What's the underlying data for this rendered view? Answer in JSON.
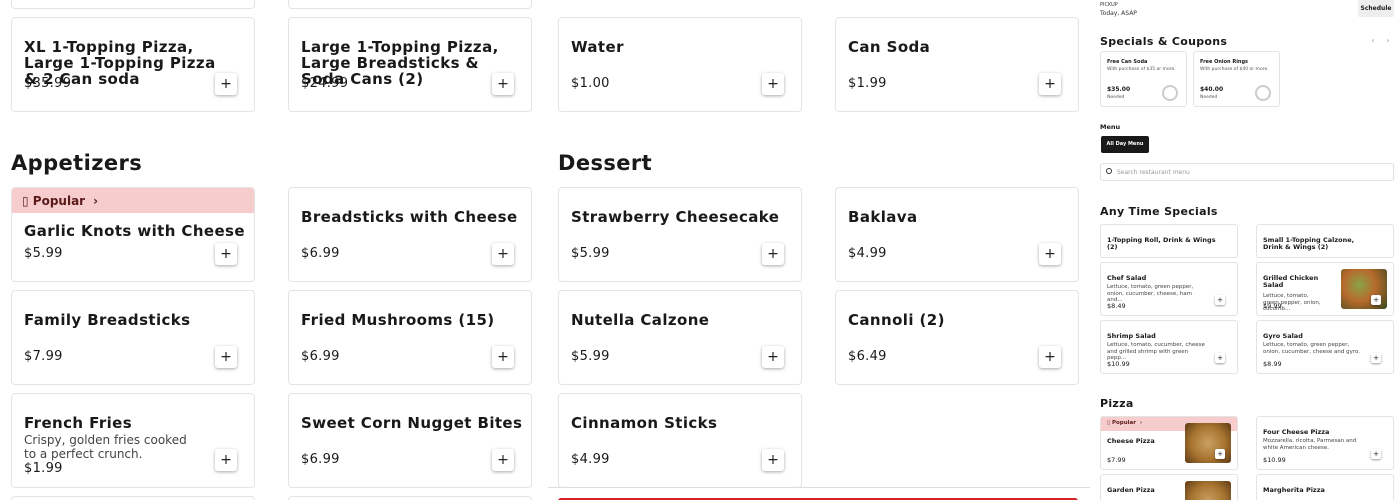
{
  "combos": [
    {
      "name": "XL 1-Topping Pizza, Large 1-Topping Pizza & 2 Can soda",
      "price": "$35.99"
    },
    {
      "name": "Large 1-Topping Pizza, Large Breadsticks & Soda Cans (2)",
      "price": "$24.99"
    },
    {
      "name": "Water",
      "price": "$1.00"
    },
    {
      "name": "Can Soda",
      "price": "$1.99"
    }
  ],
  "appetizers": {
    "title": "Appetizers",
    "popular_label": "Popular",
    "items": [
      {
        "name": "Garlic Knots with Cheese",
        "price": "$5.99"
      },
      {
        "name": "Breadsticks with Cheese",
        "price": "$6.99"
      },
      {
        "name": "Family Breadsticks",
        "price": "$7.99"
      },
      {
        "name": "Fried Mushrooms (15)",
        "price": "$6.99"
      },
      {
        "name": "French Fries",
        "desc": "Crispy, golden fries cooked to a perfect crunch.",
        "price": "$1.99"
      },
      {
        "name": "Sweet Corn Nugget Bites",
        "price": "$6.99"
      }
    ]
  },
  "dessert": {
    "title": "Dessert",
    "items": [
      {
        "name": "Strawberry Cheesecake",
        "price": "$5.99"
      },
      {
        "name": "Baklava",
        "price": "$4.99"
      },
      {
        "name": "Nutella Calzone",
        "price": "$5.99"
      },
      {
        "name": "Cannoli (2)",
        "price": "$6.49"
      },
      {
        "name": "Cinnamon Sticks",
        "price": "$4.99"
      }
    ]
  },
  "add_glyph": "+",
  "sidebar": {
    "pickup_label": "PICKUP",
    "pickup_time": "Today, ASAP",
    "schedule": "Schedule",
    "specials_title": "Specials & Coupons",
    "prev": "‹",
    "next": "›",
    "coupons": [
      {
        "title": "Free Can Soda",
        "desc": "With purchase of $35 or more.",
        "amount": "$35.00",
        "needed": "Needed"
      },
      {
        "title": "Free Onion Rings",
        "desc": "With purchase of $40 or more.",
        "amount": "$40.00",
        "needed": "Needed"
      }
    ],
    "menu_label": "Menu",
    "menu_btn": "All Day Menu",
    "search_placeholder": "Search restaurant menu",
    "anytime_title": "Any Time Specials",
    "anytime": [
      {
        "name": "1-Topping Roll, Drink & Wings (2)",
        "desc": "",
        "price": ""
      },
      {
        "name": "Small 1-Topping Calzone, Drink & Wings (2)",
        "desc": "",
        "price": ""
      },
      {
        "name": "Chef Salad",
        "desc": "Lettuce, tomato, green pepper, onion, cucumber, cheese, ham and...",
        "price": "$8.49"
      },
      {
        "name": "Grilled Chicken Salad",
        "desc": "Lettuce, tomato, green pepper, onion, cucumb...",
        "price": "$9.99"
      },
      {
        "name": "Shrimp Salad",
        "desc": "Lettuce, tomato, cucumber, cheese and grilled shrimp with green pepp...",
        "price": "$10.99"
      },
      {
        "name": "Gyro Salad",
        "desc": "Lettuce, tomato, green pepper, onion, cucumber, cheese and gyro.",
        "price": "$8.99"
      }
    ],
    "pizza_title": "Pizza",
    "popular": "Popular",
    "pizzas": [
      {
        "name": "Cheese Pizza",
        "desc": "",
        "price": "$7.99"
      },
      {
        "name": "Four Cheese Pizza",
        "desc": "Mozzarella, ricotta, Parmesan and white American cheese.",
        "price": "$10.99"
      },
      {
        "name": "Garden Pizza",
        "desc": "",
        "price": ""
      },
      {
        "name": "Margherita Pizza",
        "desc": "",
        "price": ""
      }
    ]
  }
}
